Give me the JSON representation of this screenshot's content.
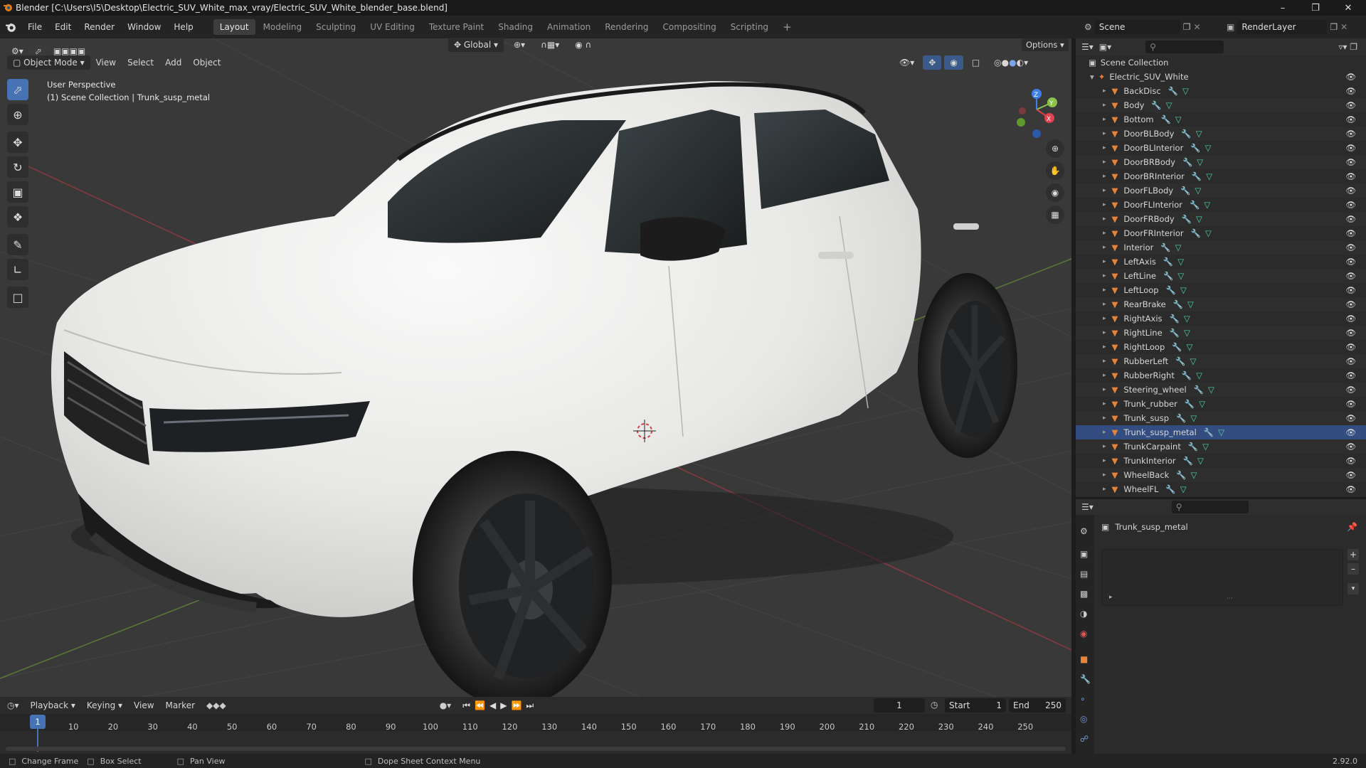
{
  "window": {
    "title": "Blender [C:\\Users\\I5\\Desktop\\Electric_SUV_White_max_vray/Electric_SUV_White_blender_base.blend]"
  },
  "menu": [
    "File",
    "Edit",
    "Render",
    "Window",
    "Help"
  ],
  "workspaces": [
    "Layout",
    "Modeling",
    "Sculpting",
    "UV Editing",
    "Texture Paint",
    "Shading",
    "Animation",
    "Rendering",
    "Compositing",
    "Scripting"
  ],
  "active_workspace": "Layout",
  "scene": {
    "label": "Scene",
    "render_layer": "RenderLayer"
  },
  "viewport_header": {
    "mode": "Object Mode",
    "menus": [
      "View",
      "Select",
      "Add",
      "Object"
    ],
    "transform_orientation": "Global",
    "options": "Options"
  },
  "viewport": {
    "perspective": "User Perspective",
    "collection_info": "(1) Scene Collection | Trunk_susp_metal",
    "gizmo_axes": [
      "Z",
      "Y",
      "X"
    ]
  },
  "outliner": {
    "root": "Scene Collection",
    "collection": "Electric_SUV_White",
    "items": [
      "BackDisc",
      "Body",
      "Bottom",
      "DoorBLBody",
      "DoorBLInterior",
      "DoorBRBody",
      "DoorBRInterior",
      "DoorFLBody",
      "DoorFLInterior",
      "DoorFRBody",
      "DoorFRInterior",
      "Interior",
      "LeftAxis",
      "LeftLine",
      "LeftLoop",
      "RearBrake",
      "RightAxis",
      "RightLine",
      "RightLoop",
      "RubberLeft",
      "RubberRight",
      "Steering_wheel",
      "Trunk_rubber",
      "Trunk_susp",
      "Trunk_susp_metal",
      "TrunkCarpaint",
      "TrunkInterior",
      "WheelBack",
      "WheelFL"
    ],
    "selected": "Trunk_susp_metal"
  },
  "properties": {
    "object_name": "Trunk_susp_metal"
  },
  "timeline": {
    "menus": [
      "Playback",
      "Keying",
      "View",
      "Marker"
    ],
    "current_frame": "1",
    "start_label": "Start",
    "start": "1",
    "end_label": "End",
    "end": "250",
    "ticks": [
      "10",
      "20",
      "30",
      "40",
      "50",
      "60",
      "70",
      "80",
      "90",
      "100",
      "110",
      "120",
      "130",
      "140",
      "150",
      "160",
      "170",
      "180",
      "190",
      "200",
      "210",
      "220",
      "230",
      "240",
      "250"
    ],
    "playhead": "1"
  },
  "statusbar": {
    "change_frame": "Change Frame",
    "box_select": "Box Select",
    "pan_view": "Pan View",
    "context_menu": "Dope Sheet Context Menu",
    "version": "2.92.0"
  },
  "colors": {
    "accent": "#4772b3",
    "selected_row": "#334d80",
    "mesh_icon": "#e8843a",
    "modifier_icon": "#6f9de0",
    "data_icon": "#4ed4a8",
    "axis_x": "#e0424f",
    "axis_y": "#8bc34a",
    "axis_z": "#3f7fe6"
  }
}
